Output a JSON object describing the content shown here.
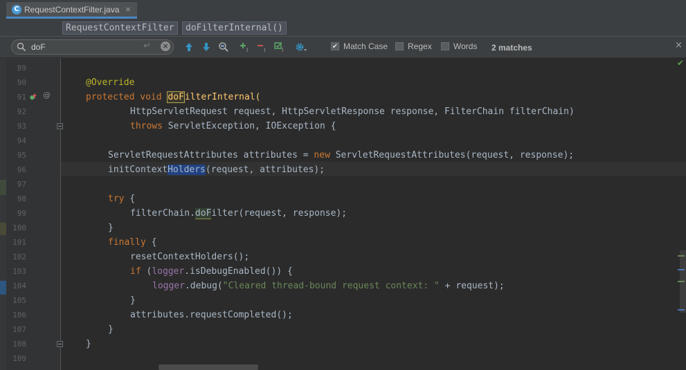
{
  "tab": {
    "icon_letter": "C",
    "filename": "RequestContextFilter.java",
    "close": "×"
  },
  "breadcrumb": {
    "class_name": "RequestContextFilter",
    "method_name": "doFilterInternal()"
  },
  "search": {
    "query": "doF",
    "clear": "×",
    "enter_glyph": "↵",
    "options": [
      {
        "label": "Match Case",
        "checked": true
      },
      {
        "label": "Regex",
        "checked": false
      },
      {
        "label": "Words",
        "checked": false
      }
    ],
    "match_count": "2 matches",
    "close": "×"
  },
  "editor": {
    "line_numbers": [
      "89",
      "90",
      "91",
      "92",
      "93",
      "94",
      "95",
      "96",
      "97",
      "98",
      "99",
      "100",
      "101",
      "102",
      "103",
      "104",
      "105",
      "106",
      "107",
      "108",
      "109"
    ],
    "override_gutter_icon": "override-icon",
    "annotation_gutter_glyph": "@",
    "lines": {
      "l90": {
        "annotation": "@Override"
      },
      "l91": {
        "kw1": "protected",
        "kw2": "void",
        "match": "doF",
        "rest": "ilterInternal("
      },
      "l92": {
        "text": "HttpServletRequest request, HttpServletResponse response, FilterChain filterChain)"
      },
      "l93": {
        "kw": "throws",
        "rest": " ServletException, IOException {"
      },
      "l95": {
        "a": "ServletRequestAttributes attributes = ",
        "kw": "new",
        "b": " ServletRequestAttributes(request, response);"
      },
      "l96": {
        "a": "initContext",
        "sel": "Holders",
        "b": "(request, attributes);"
      },
      "l98": {
        "kw": "try",
        "rest": " {"
      },
      "l99": {
        "a": "filterChain.",
        "match": "doF",
        "b": "ilter(request, response);"
      },
      "l100": {
        "text": "}"
      },
      "l101": {
        "kw": "finally",
        "rest": " {"
      },
      "l102": {
        "text": "resetContextHolders();"
      },
      "l103": {
        "kw": "if",
        "a": " (",
        "field": "logger",
        "b": ".isDebugEnabled()) {"
      },
      "l104": {
        "field": "logger",
        "a": ".debug(",
        "str": "\"Cleared thread-bound request context: \"",
        "b": " + request);"
      },
      "l105": {
        "text": "}"
      },
      "l106": {
        "text": "attributes.requestCompleted();"
      },
      "l107": {
        "text": "}"
      },
      "l108": {
        "text": "}"
      }
    }
  },
  "colors": {
    "editor_bg": "#2b2b2b",
    "keyword": "#cc7832",
    "annotation": "#bbb529",
    "string": "#6a8759",
    "field": "#9876aa",
    "tab_underline": "#4a88c7",
    "selection": "#214283"
  }
}
